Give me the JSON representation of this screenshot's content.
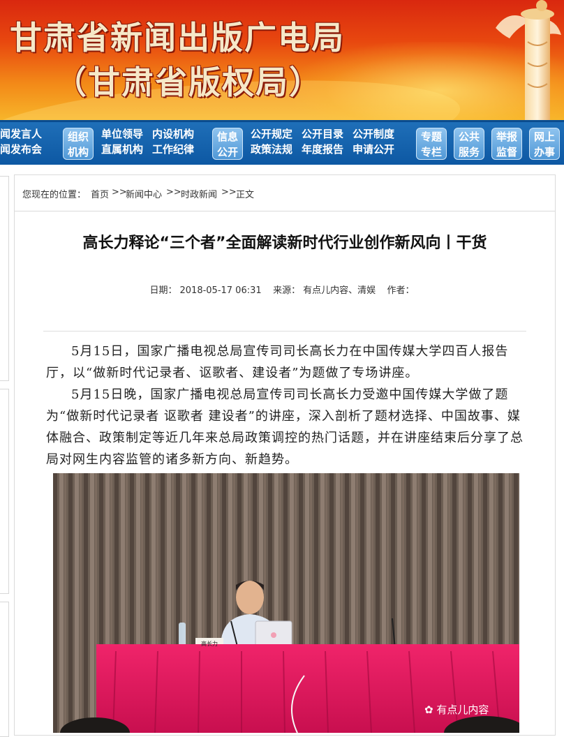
{
  "banner": {
    "title": "甘肃省新闻出版广电局",
    "subtitle": "（甘肃省版权局）"
  },
  "nav": {
    "col1": [
      "闻发言人",
      "闻发布会"
    ],
    "btn_org": [
      "组织",
      "机构"
    ],
    "col2": [
      "单位领导",
      "直属机构"
    ],
    "col3": [
      "内设机构",
      "工作纪律"
    ],
    "btn_info": [
      "信息",
      "公开"
    ],
    "col4": [
      "公开规定",
      "政策法规"
    ],
    "col5": [
      "公开目录",
      "年度报告"
    ],
    "col6": [
      "公开制度",
      "申请公开"
    ],
    "btn_topic": [
      "专题",
      "专栏"
    ],
    "btn_service": [
      "公共",
      "服务"
    ],
    "btn_report": [
      "举报",
      "监督"
    ],
    "btn_online": [
      "网上",
      "办事"
    ]
  },
  "breadcrumb": {
    "prefix": "您现在的位置：",
    "items": [
      "首页",
      "新闻中心",
      "时政新闻",
      "正文"
    ],
    "sep": ">>"
  },
  "article": {
    "title": "高长力释论“三个者”全面解读新时代行业创作新风向丨干货",
    "date_label": "日期：",
    "date": "2018-05-17 06:31",
    "source_label": "来源：",
    "source": "有点儿内容、清娱",
    "author_label": "作者：",
    "author": "",
    "paragraphs": [
      "5月15日，国家广播电视总局宣传司司长高长力在中国传媒大学四百人报告厅，以“做新时代记录者、讴歌者、建设者”为题做了专场讲座。",
      "5月15日晚，国家广播电视总局宣传司司长高长力受邀中国传媒大学做了题为“做新时代记录者 讴歌者 建设者”的讲座，深入剖析了题材选择、中国故事、媒体融合、政策制定等近几年来总局政策调控的热门话题，并在讲座结束后分享了总局对网生内容监管的诸多新方向、新趋势。"
    ]
  },
  "photo": {
    "nameplate": "高长力",
    "watermark": "有点儿内容"
  },
  "colors": {
    "nav_blue": "#0d58a3",
    "banner_red": "#d9280f",
    "table_red": "#e0165a"
  }
}
